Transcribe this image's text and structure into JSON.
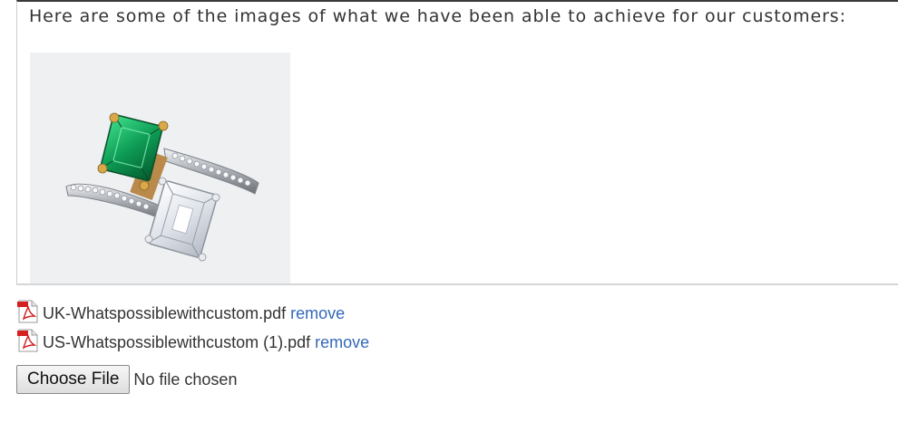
{
  "editor": {
    "text": "Here are some of the images of what we have been able to achieve for our customers:",
    "image_alt": "Emerald and diamond toi et moi ring"
  },
  "attachments": [
    {
      "filename": "UK-Whatspossiblewithcustom.pdf",
      "remove_label": "remove",
      "icon": "pdf-icon"
    },
    {
      "filename": "US-Whatspossiblewithcustom (1).pdf",
      "remove_label": "remove",
      "icon": "pdf-icon"
    }
  ],
  "file_input": {
    "button_label": "Choose File",
    "status": "No file chosen"
  },
  "colors": {
    "link": "#3369b8",
    "pdf_red": "#d42020",
    "text": "#333333"
  }
}
